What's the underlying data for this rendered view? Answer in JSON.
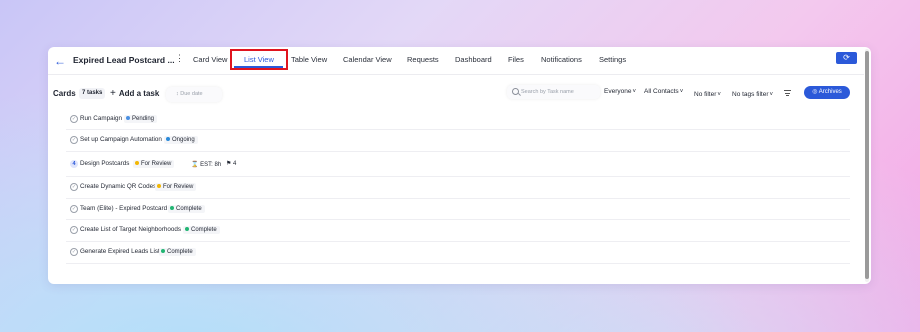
{
  "header": {
    "back_icon": "arrow-left-icon",
    "project_title": "Expired Lead Postcard ...",
    "more_icon": "kebab-icon",
    "tabs": [
      {
        "label": "Card View",
        "active": false
      },
      {
        "label": "List View",
        "active": true
      },
      {
        "label": "Table View",
        "active": false
      },
      {
        "label": "Calendar View",
        "active": false
      },
      {
        "label": "Requests",
        "active": false
      },
      {
        "label": "Dashboard",
        "active": false
      },
      {
        "label": "Files",
        "active": false
      },
      {
        "label": "Notifications",
        "active": false
      },
      {
        "label": "Settings",
        "active": false
      }
    ],
    "refresh_icon": "refresh-icon"
  },
  "toolbar": {
    "cards_label": "Cards",
    "task_count": "7 tasks",
    "add_task_label": "Add a task",
    "due_date_label": "Due date",
    "search_placeholder": "Search by Task name",
    "filters": [
      "Everyone",
      "All Contacts",
      "No filter",
      "No tags filter"
    ],
    "archives_label": "Archives"
  },
  "colors": {
    "accent": "#2b59d9",
    "highlight": "#e0141e",
    "pending": "#4a90e2",
    "ongoing": "#2b8ad9",
    "for_review": "#f2b705",
    "complete": "#22b573"
  },
  "tasks": [
    {
      "name": "Run Campaign",
      "status": "Pending",
      "status_key": "pending"
    },
    {
      "name": "Set up Campaign Automation",
      "status": "Ongoing",
      "status_key": "ongoing"
    },
    {
      "name": "Design Postcards",
      "status": "For Review",
      "status_key": "for_review",
      "subtask_count": "4",
      "est": "EST: 8h",
      "comments": "4"
    },
    {
      "name": "Create Dynamic QR Codes",
      "status": "For Review",
      "status_key": "for_review"
    },
    {
      "name": "Team (Elite) - Expired Postcard",
      "status": "Complete",
      "status_key": "complete"
    },
    {
      "name": "Create List of Target Neighborhoods",
      "status": "Complete",
      "status_key": "complete"
    },
    {
      "name": "Generate Expired Leads List",
      "status": "Complete",
      "status_key": "complete"
    }
  ]
}
